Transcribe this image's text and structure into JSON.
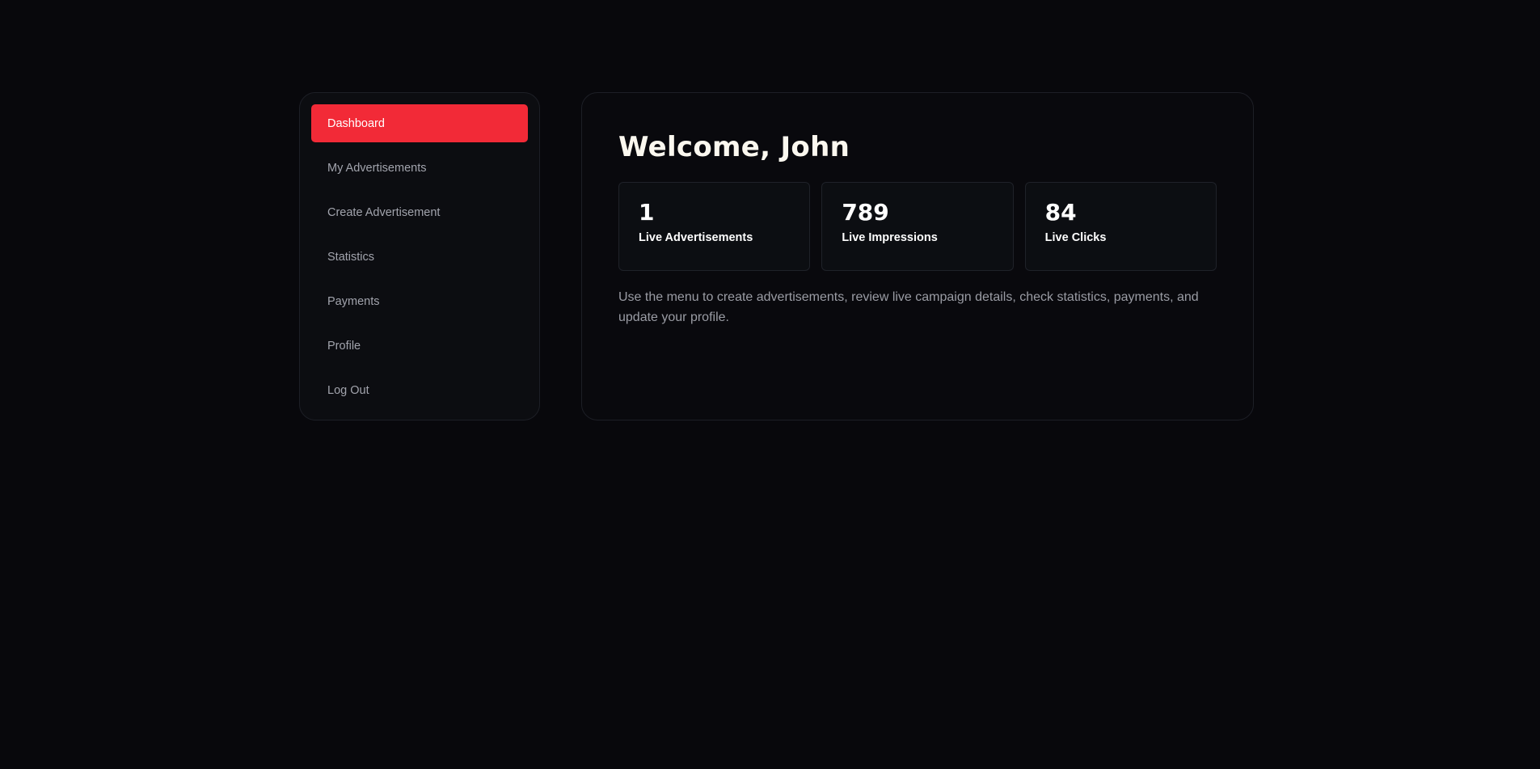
{
  "sidebar": {
    "items": [
      {
        "label": "Dashboard",
        "active": true
      },
      {
        "label": "My Advertisements",
        "active": false
      },
      {
        "label": "Create Advertisement",
        "active": false
      },
      {
        "label": "Statistics",
        "active": false
      },
      {
        "label": "Payments",
        "active": false
      },
      {
        "label": "Profile",
        "active": false
      },
      {
        "label": "Log Out",
        "active": false
      }
    ]
  },
  "main": {
    "title": "Welcome, John",
    "stats": [
      {
        "value": "1",
        "label": "Live Advertisements"
      },
      {
        "value": "789",
        "label": "Live Impressions"
      },
      {
        "value": "84",
        "label": "Live Clicks"
      }
    ],
    "description": "Use the menu to create advertisements, review live campaign details, check statistics, payments, and update your profile."
  },
  "colors": {
    "background": "#08080c",
    "accent": "#f22a37",
    "card": "#0c0e12",
    "text_muted": "#9a9ca4"
  }
}
